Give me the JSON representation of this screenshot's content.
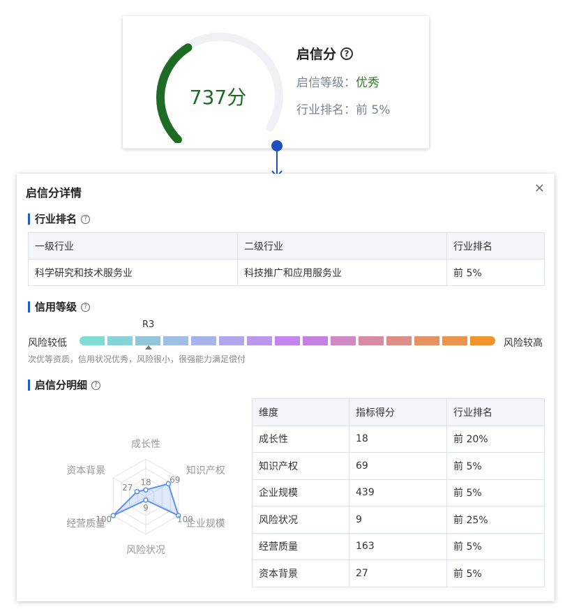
{
  "score_card": {
    "score_text": "737分",
    "title": "启信分",
    "grade_label": "启信等级：",
    "grade_value": "优秀",
    "rank_label": "行业排名：",
    "rank_value": "前 5%",
    "colors": {
      "arc": "#1e6b23",
      "track": "#eff1f4",
      "grade": "#2f7a24"
    }
  },
  "panel": {
    "title": "启信分详情",
    "close_symbol": "×",
    "industry_section": {
      "title": "行业排名",
      "headers": [
        "一级行业",
        "二级行业",
        "行业排名"
      ],
      "row": [
        "科学研究和技术服务业",
        "科技推广和应用服务业",
        "前 5%"
      ]
    },
    "credit_section": {
      "title": "信用等级",
      "low_label": "风险较低",
      "high_label": "风险较高",
      "current_level": "R3",
      "current_index": 2,
      "description": "次优等资质，信用状况优秀，风险很小，很强能力满足偿付",
      "segment_colors": [
        "#7fdcd2",
        "#88d3d9",
        "#93c5dd",
        "#9ebfe4",
        "#a8b3ec",
        "#b0a6ed",
        "#bb98ee",
        "#c486ee",
        "#c481e0",
        "#cf89c5",
        "#d78ca3",
        "#dd8f8a",
        "#e69263",
        "#ec9350",
        "#f2942e"
      ]
    },
    "detail_section": {
      "title": "启信分明细",
      "headers": [
        "维度",
        "指标得分",
        "行业排名"
      ],
      "rows": [
        [
          "成长性",
          "18",
          "前 20%"
        ],
        [
          "知识产权",
          "69",
          "前 5%"
        ],
        [
          "企业规模",
          "439",
          "前 5%"
        ],
        [
          "风险状况",
          "9",
          "前 25%"
        ],
        [
          "经营质量",
          "163",
          "前 5%"
        ],
        [
          "资本背景",
          "27",
          "前 5%"
        ]
      ]
    }
  },
  "radar": {
    "indicators": [
      "成长性",
      "知识产权",
      "企业规模",
      "风险状况",
      "经营质量",
      "资本背景"
    ],
    "values": [
      18,
      69,
      100,
      9,
      100,
      27
    ],
    "max": 100,
    "colors": {
      "line": "#5b8ff9",
      "fill": "#5b8ff9",
      "grid": "#e2e2e2",
      "label": "#999999",
      "value": "#888888"
    }
  }
}
